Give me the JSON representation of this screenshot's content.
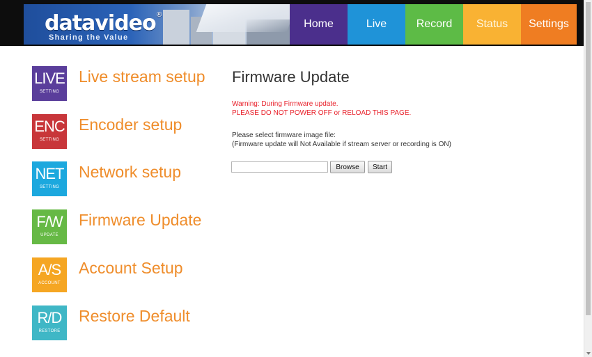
{
  "brand": {
    "logo_text": "datavideo",
    "registered": "®",
    "tagline": "Sharing the Value"
  },
  "nav": [
    {
      "label": "Home",
      "color": "#4b2f8c"
    },
    {
      "label": "Live",
      "color": "#1f93d8"
    },
    {
      "label": "Record",
      "color": "#5dbb46"
    },
    {
      "label": "Status",
      "color": "#f9b233"
    },
    {
      "label": "Settings",
      "color": "#ef7d22"
    }
  ],
  "menu": [
    {
      "icon_big": "LIVE",
      "icon_small": "SETTING",
      "label": "Live stream setup",
      "color": "#5a3e9b",
      "icon": "live-setting-icon"
    },
    {
      "icon_big": "ENC",
      "icon_small": "SETTING",
      "label": "Encoder setup",
      "color": "#c8363a",
      "icon": "enc-setting-icon"
    },
    {
      "icon_big": "NET",
      "icon_small": "SETTING",
      "label": "Network setup",
      "color": "#1ca8de",
      "icon": "net-setting-icon"
    },
    {
      "icon_big": "F/W",
      "icon_small": "UPDATE",
      "label": "Firmware Update",
      "color": "#66b945",
      "icon": "fw-update-icon"
    },
    {
      "icon_big": "A/S",
      "icon_small": "ACCOUNT",
      "label": "Account Setup",
      "color": "#f5a623",
      "icon": "account-setup-icon"
    },
    {
      "icon_big": "R/D",
      "icon_small": "RESTORE",
      "label": "Restore Default",
      "color": "#3fb7c6",
      "icon": "restore-default-icon"
    }
  ],
  "main": {
    "title": "Firmware Update",
    "warning_line1": "Warning: During Firmware update.",
    "warning_line2": "PLEASE DO NOT POWER OFF or RELOAD THIS PAGE.",
    "instruction_line1": "Please select firmware image file:",
    "instruction_line2": "(Firmware update will Not Available if stream server or recording is ON)",
    "file_value": "",
    "browse_label": "Browse",
    "start_label": "Start"
  },
  "colors": {
    "menu_text": "#ef8d2b",
    "warning_text": "#e8202a",
    "header_bg": "#0d0d0d"
  }
}
